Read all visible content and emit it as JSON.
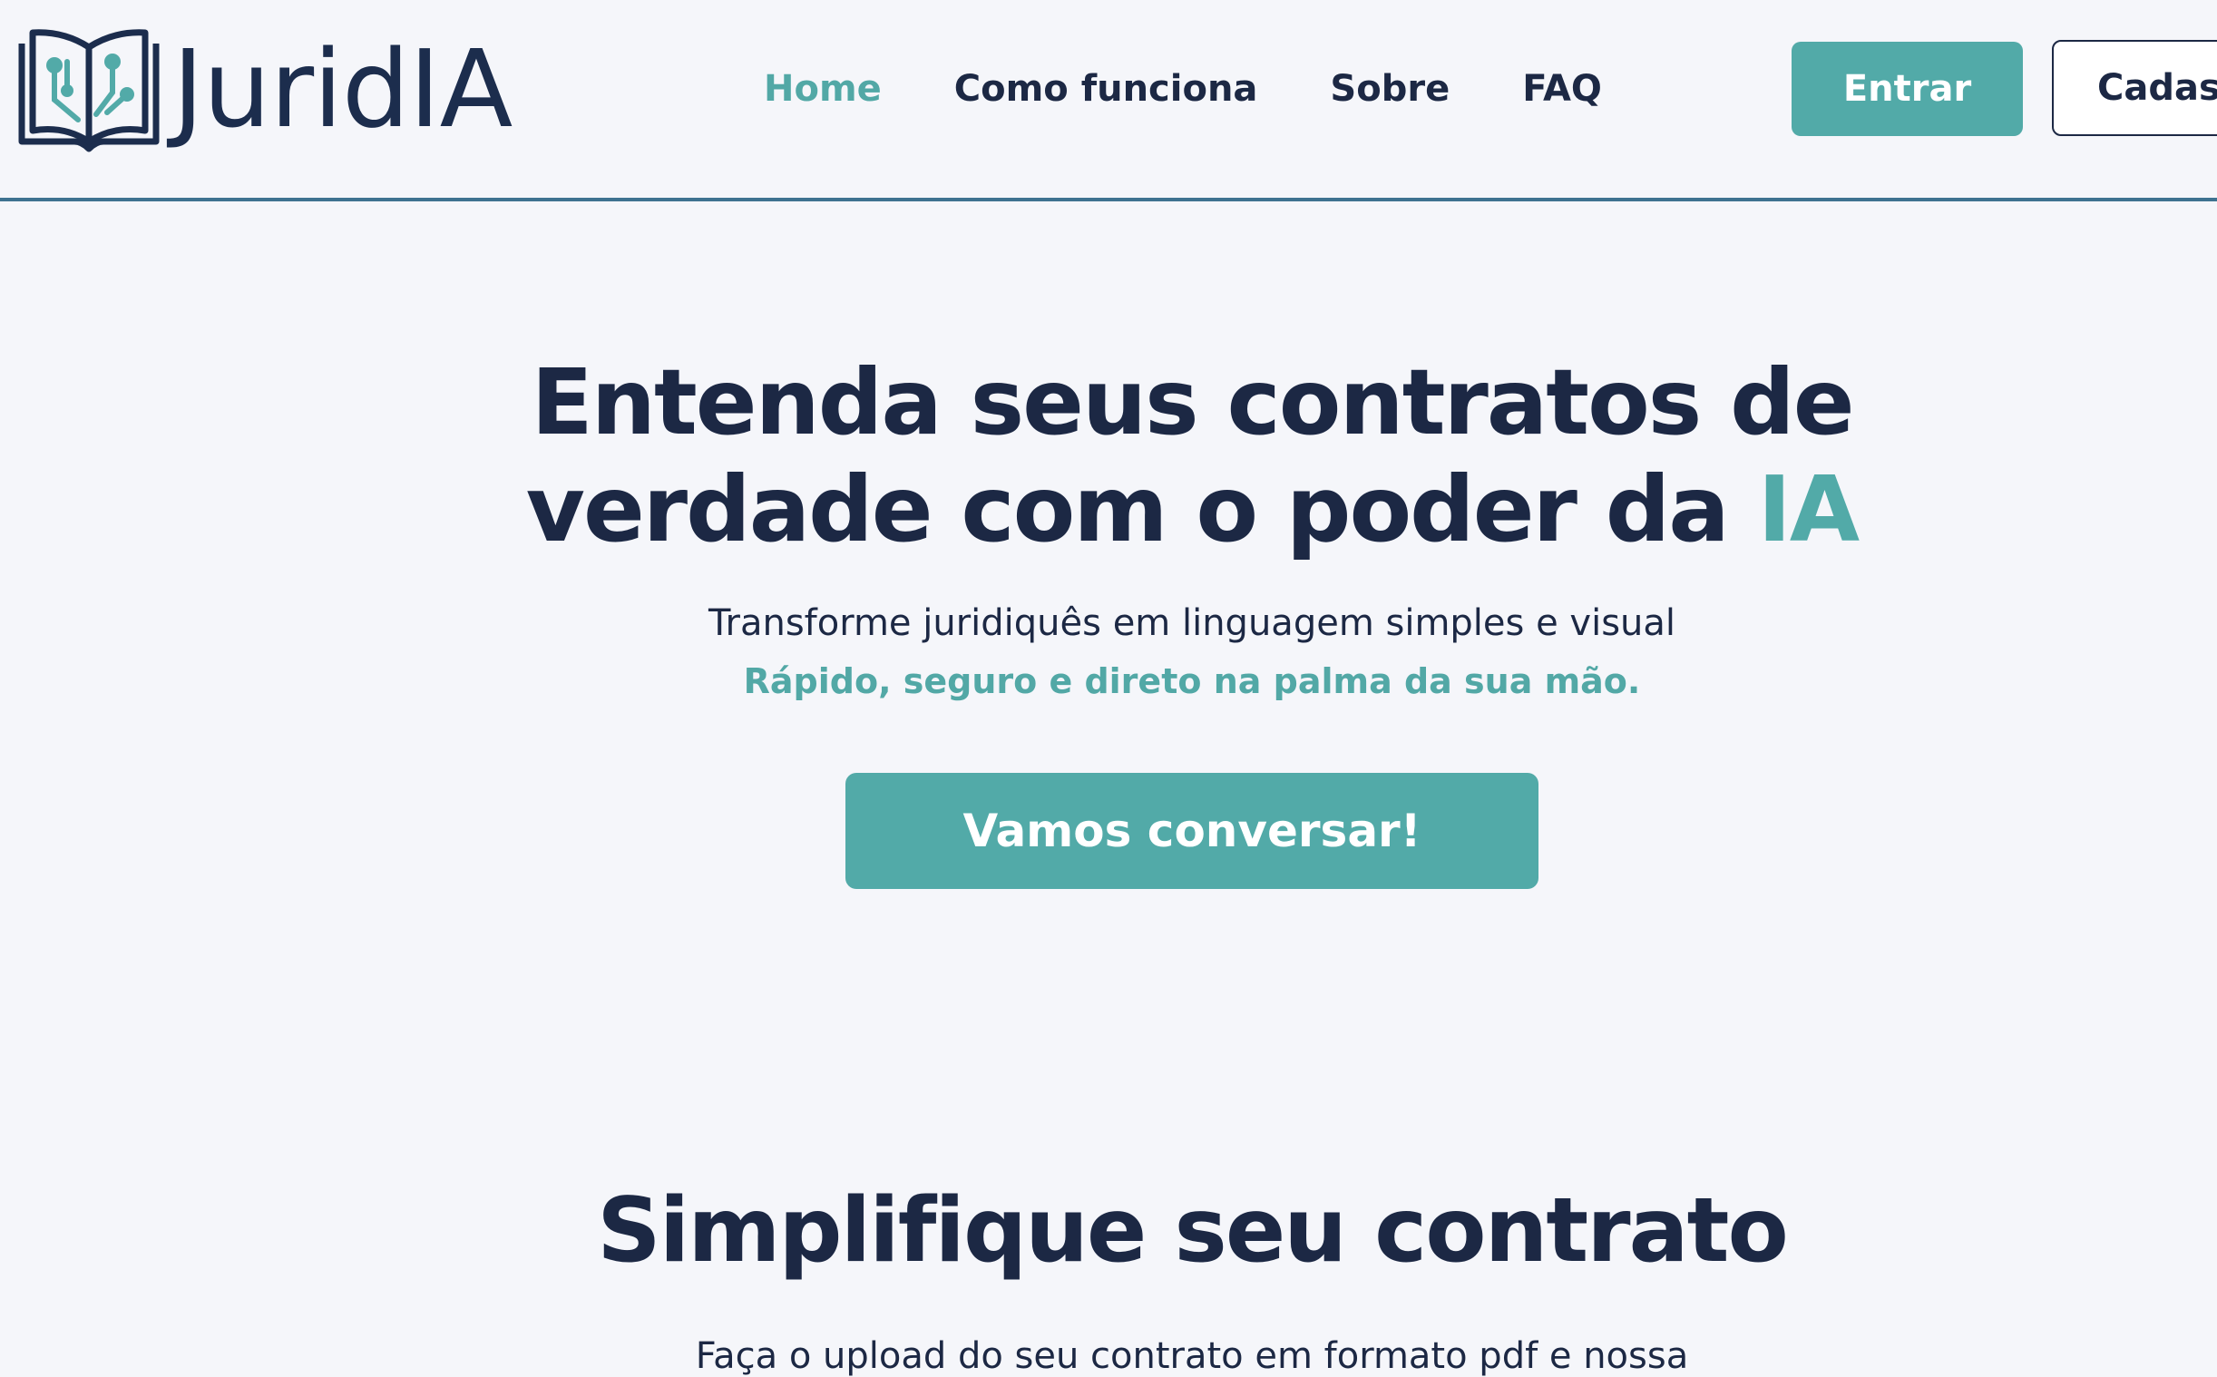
{
  "brand": {
    "name": "JuridIA",
    "logo_icon": "open-book-circuit-icon",
    "colors": {
      "primary": "#1c2d4d",
      "accent": "#52aaa8",
      "text": "#1c2844",
      "background": "#f5f6fa",
      "divider": "#3e7290"
    }
  },
  "nav": {
    "links": [
      {
        "label": "Home",
        "active": true
      },
      {
        "label": "Como funciona",
        "active": false
      },
      {
        "label": "Sobre",
        "active": false
      },
      {
        "label": "FAQ",
        "active": false
      }
    ],
    "login_label": "Entrar",
    "signup_label": "Cadastrar"
  },
  "hero": {
    "title_line1": "Entenda seus contratos de",
    "title_line2": "verdade com o poder da ",
    "title_accent": "IA",
    "subtitle": "Transforme juridiquês em linguagem simples e visual",
    "tagline": "Rápido, seguro e direto na palma da sua mão.",
    "cta_label": "Vamos conversar!"
  },
  "simplify": {
    "title": "Simplifique seu contrato",
    "text": "Faça o upload do seu contrato em formato pdf e nossa"
  }
}
